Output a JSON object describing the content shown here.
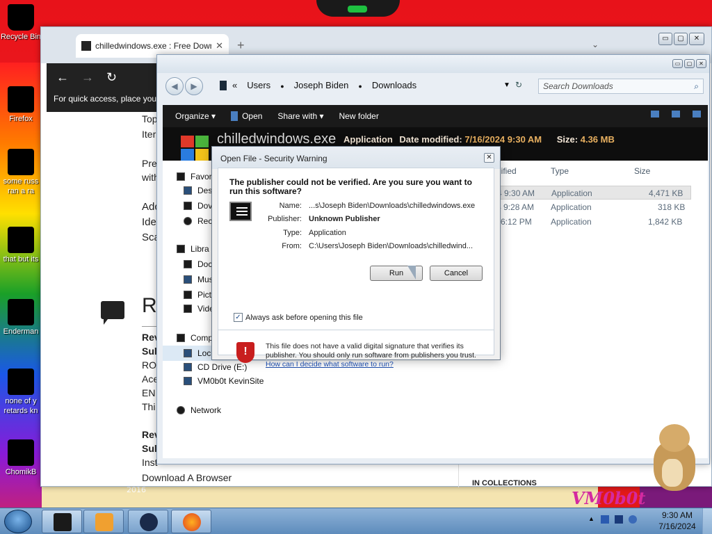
{
  "desktop": {
    "icons": [
      {
        "label": "Recycle Bin"
      },
      {
        "label": "Firefox"
      },
      {
        "label": "some russ"
      },
      {
        "label": "ran a ra"
      },
      {
        "label": "that but its"
      },
      {
        "label": "Enderman"
      },
      {
        "label": "none of y"
      },
      {
        "label": "retards kn"
      },
      {
        "label": "ChomikB"
      }
    ],
    "wallpaper_year": "2016",
    "wallpaper_logo": "VM0b0t"
  },
  "browser": {
    "tab_title": "chilledwindows.exe : Free Down",
    "tab_close": "✕",
    "new_tab": "+",
    "tab_menu": "⌄",
    "nav": {
      "back": "←",
      "forward": "→",
      "reload": "↻"
    },
    "hint": "For quick access, place your",
    "window_buttons": {
      "minimize": "▭",
      "maximize": "▢",
      "close": "✕"
    },
    "content_lines": [
      "Top",
      "Iter",
      "Pre",
      "with",
      "Adc",
      "Ide",
      "Sca"
    ],
    "section_heading": "R",
    "review_lines": [
      "Rev",
      "Sul",
      "RO",
      "Ace",
      "EN",
      "Thi",
      "Rev",
      "Sul",
      "Inst",
      "Download A Browser"
    ],
    "collections_text": "IN COLLECTIONS"
  },
  "explorer": {
    "window_buttons": {
      "minimize": "▭",
      "maximize": "▢",
      "close": "✕"
    },
    "nav": {
      "back": "◀",
      "forward": "▶"
    },
    "path_prefix": "«",
    "path": [
      "Users",
      "Joseph Biden",
      "Downloads"
    ],
    "path_separator": "●",
    "path_dropdown": "▼",
    "refresh": "↻",
    "search_placeholder": "Search Downloads",
    "search_icon": "⌕",
    "toolbar": {
      "organize": "Organize ▾",
      "open": "Open",
      "share_with": "Share with ▾",
      "new_folder": "New folder"
    },
    "details": {
      "filename": "chilledwindows.exe",
      "type": "Application",
      "modified_label": "Date modified:",
      "modified_value": "7/16/2024 9:30 AM",
      "size_label": "Size:",
      "size_value": "4.36 MB"
    },
    "sidebar": [
      {
        "label": "Favor"
      },
      {
        "label": "Des"
      },
      {
        "label": "Dov"
      },
      {
        "label": "Rec"
      },
      {
        "label": "Libra"
      },
      {
        "label": "Doc"
      },
      {
        "label": "Mus"
      },
      {
        "label": "Pict"
      },
      {
        "label": "Vide"
      },
      {
        "label": "Comp"
      },
      {
        "label": "Loc"
      },
      {
        "label": "CD Drive (E:)"
      },
      {
        "label": "VM0b0t KevinSite"
      },
      {
        "label": "Network"
      }
    ],
    "columns": {
      "modified": "dified",
      "type": "Type",
      "size": "Size"
    },
    "rows": [
      {
        "modified": "4 9:30 AM",
        "type": "Application",
        "size": "4,471 KB"
      },
      {
        "modified": "4 9:28 AM",
        "type": "Application",
        "size": "318 KB"
      },
      {
        "modified": "6:12 PM",
        "type": "Application",
        "size": "1,842 KB"
      }
    ]
  },
  "dialog": {
    "title": "Open File - Security Warning",
    "close": "✕",
    "question": "The publisher could not be verified.  Are you sure you want to run this software?",
    "fields": [
      {
        "key": "Name:",
        "value": "...s\\Joseph Biden\\Downloads\\chilledwindows.exe"
      },
      {
        "key": "Publisher:",
        "value": "Unknown Publisher"
      },
      {
        "key": "Type:",
        "value": "Application"
      },
      {
        "key": "From:",
        "value": "C:\\Users\\Joseph Biden\\Downloads\\chilledwind..."
      }
    ],
    "run_label": "Run",
    "cancel_label": "Cancel",
    "checkbox_label": "Always ask before opening this file",
    "checkbox_mark": "✓",
    "checkbox_checked": true,
    "warning_text": "This file does not have a valid digital signature that verifies its publisher.  You should only run software from publishers you trust.",
    "warning_link": "How can I decide what software to run?",
    "shield_glyph": "!"
  },
  "taskbar": {
    "time": "9:30 AM",
    "date": "7/16/2024",
    "tray_arrow": "▲"
  }
}
